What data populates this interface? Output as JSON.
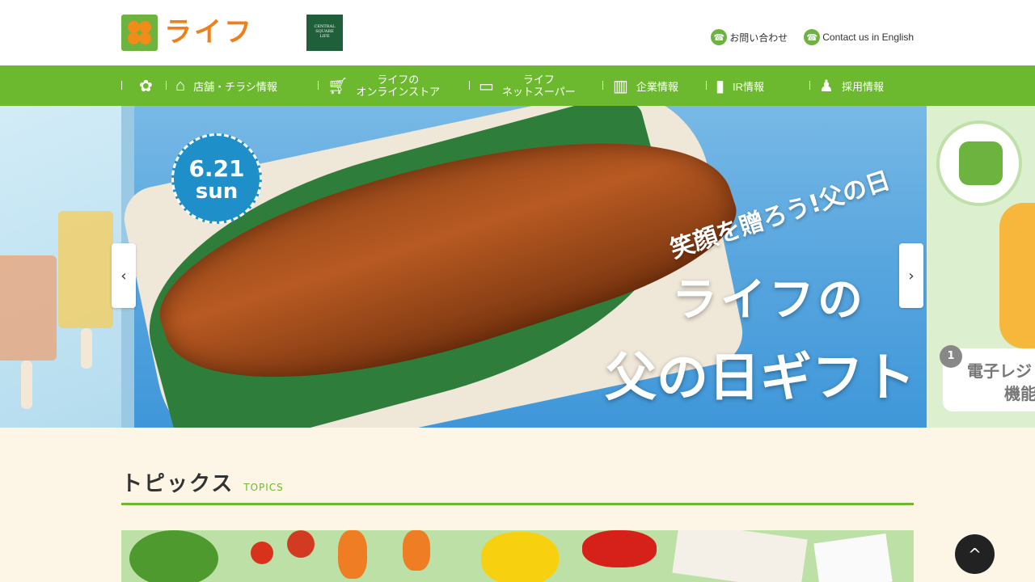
{
  "header": {
    "logo_text": "ライフ",
    "partner_logo_lines": [
      "CENTRAL",
      "SQUARE",
      "LIFE"
    ],
    "links": [
      {
        "label": "お問い合わせ",
        "icon": "phone-icon"
      },
      {
        "label": "Contact us in English",
        "icon": "phone-icon"
      }
    ]
  },
  "nav": {
    "items": [
      {
        "icon": "clover-icon",
        "label": ""
      },
      {
        "icon": "store-icon",
        "label": "店舗・チラシ情報"
      },
      {
        "icon": "cart-icon",
        "line1": "ライフの",
        "line2": "オンラインストア"
      },
      {
        "icon": "monitor-icon",
        "line1": "ライフ",
        "line2": "ネットスーパー"
      },
      {
        "icon": "building-icon",
        "label": "企業情報"
      },
      {
        "icon": "chart-icon",
        "label": "IR情報"
      },
      {
        "icon": "person-icon",
        "label": "採用情報"
      }
    ]
  },
  "carousel": {
    "date_line1": "6.21",
    "date_line2": "sun",
    "tagline": "笑顔を贈ろう!父の日",
    "headline1": "ライフの",
    "headline2": "父の日ギフト",
    "side_badge_num": "1",
    "side_text1": "電子レジ",
    "side_text2": "機能",
    "prev_label": "‹",
    "next_label": "›"
  },
  "topics": {
    "title": "トピックス",
    "subtitle": "TOPICS"
  },
  "to_top_label": "^"
}
